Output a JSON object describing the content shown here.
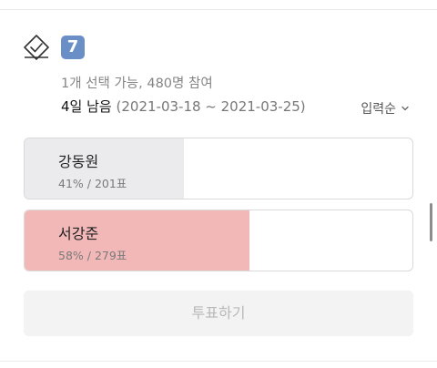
{
  "poll": {
    "emoji": "7",
    "meta": "1개 선택 가능, 480명 참여",
    "remaining": "4일 남음",
    "date_range": "(2021-03-18 ~ 2021-03-25)",
    "sort_label": "입력순",
    "options": [
      {
        "name": "강동원",
        "stats": "41% / 201표",
        "percent": 41,
        "fill_color": "#ebebed"
      },
      {
        "name": "서강준",
        "stats": "58% / 279표",
        "percent": 58,
        "fill_color": "#f2b8b8"
      }
    ],
    "vote_button": "투표하기"
  }
}
